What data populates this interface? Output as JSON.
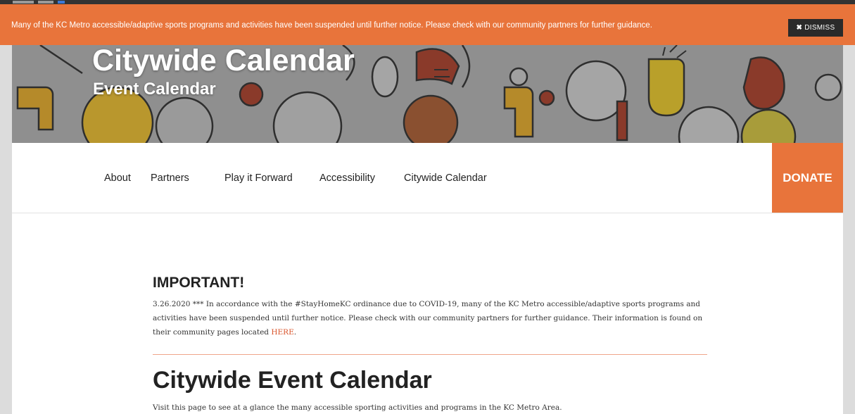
{
  "notice": {
    "text": "Many of the KC Metro accessible/adaptive sports programs and activities have been suspended until further notice.  Please check with our community partners for further guidance.",
    "dismiss_label": "DISMISS"
  },
  "hero": {
    "title": "Citywide Calendar",
    "subtitle": "Event Calendar"
  },
  "nav": {
    "items": [
      "About",
      "Partners",
      "Play it Forward",
      "Accessibility",
      "Citywide Calendar"
    ],
    "donate_label": "DONATE"
  },
  "content": {
    "important_heading": "IMPORTANT!",
    "important_text": "3.26.2020 *** In accordance with the #StayHomeKC ordinance due to COVID-19, many of the KC Metro accessible/adaptive sports programs and activities have been suspended until further notice.  Please check with our community partners for further guidance.  Their information is found on their community pages located ",
    "important_link": "HERE",
    "important_end": ".",
    "calendar_heading": "Citywide Event Calendar",
    "calendar_intro": "Visit this page to see at a glance the many accessible sporting activities and programs in the KC Metro Area."
  },
  "colors": {
    "accent": "#e8743b",
    "link": "#d9542b",
    "dismiss_bg": "#2a2a2a"
  },
  "icons": [
    "close-icon",
    "sports-pattern"
  ]
}
